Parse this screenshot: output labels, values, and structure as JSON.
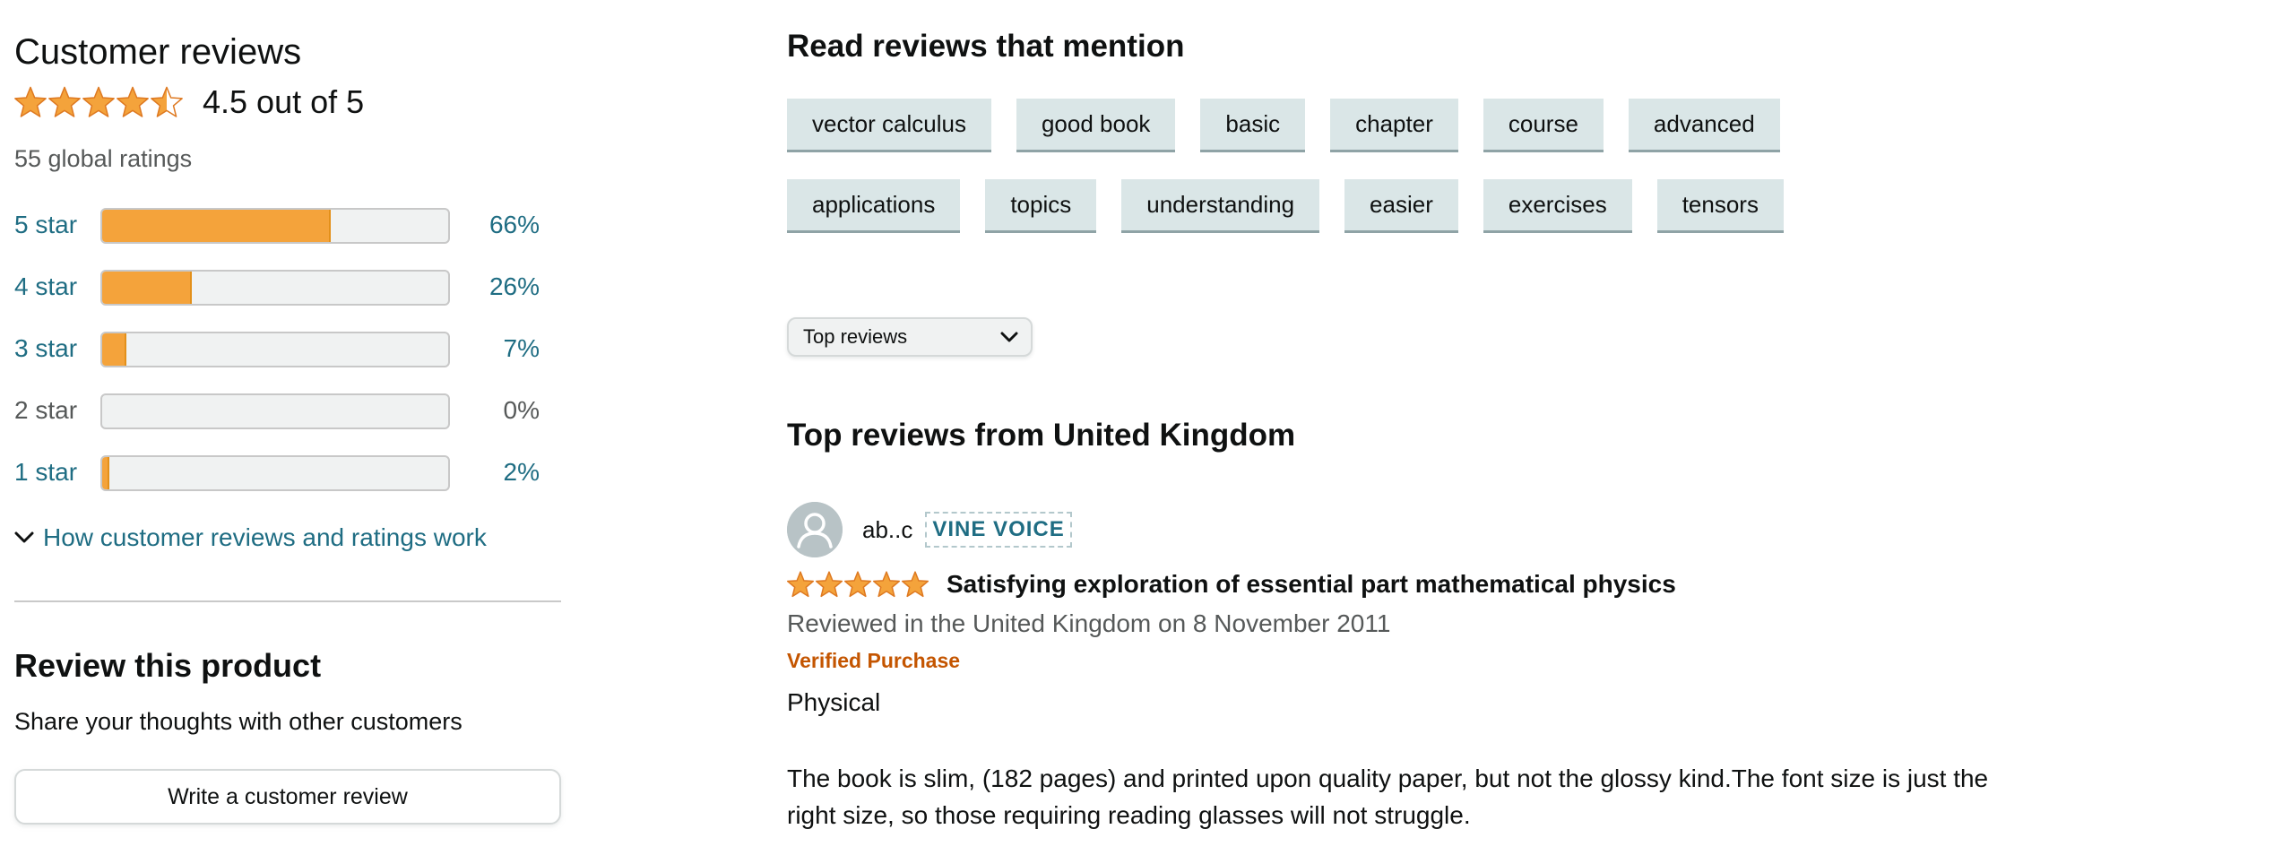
{
  "colors": {
    "link": "#1f6d83",
    "star": "#f4a33b",
    "verified": "#c45500",
    "chip_bg": "#dae6e7",
    "bar_bg": "#f0f2f2"
  },
  "summary": {
    "title": "Customer reviews",
    "rating": 4.5,
    "rating_text": "4.5 out of 5",
    "global_ratings": "55 global ratings"
  },
  "histogram": [
    {
      "label": "5 star",
      "percent_text": "66%",
      "percent": 66,
      "link": true
    },
    {
      "label": "4 star",
      "percent_text": "26%",
      "percent": 26,
      "link": true
    },
    {
      "label": "3 star",
      "percent_text": "7%",
      "percent": 7,
      "link": true
    },
    {
      "label": "2 star",
      "percent_text": "0%",
      "percent": 0,
      "link": false
    },
    {
      "label": "1 star",
      "percent_text": "2%",
      "percent": 2,
      "link": true
    }
  ],
  "how_link": "How customer reviews and ratings work",
  "review_product": {
    "title": "Review this product",
    "subtitle": "Share your thoughts with other customers",
    "button": "Write a customer review"
  },
  "mentions": {
    "title": "Read reviews that mention",
    "row1": [
      "vector calculus",
      "good book",
      "basic",
      "chapter",
      "course",
      "advanced"
    ],
    "row2": [
      "applications",
      "topics",
      "understanding",
      "easier",
      "exercises",
      "tensors"
    ]
  },
  "sort": {
    "selected": "Top reviews",
    "icon": "chevron-down-icon"
  },
  "top_reviews_title": "Top reviews from United Kingdom",
  "review": {
    "reviewer": "ab..c",
    "badge": "VINE VOICE",
    "rating": 5,
    "title": "Satisfying exploration of essential part mathematical physics",
    "date": "Reviewed in the United Kingdom on 8 November 2011",
    "verified": "Verified Purchase",
    "format": "Physical",
    "body": "The book is slim, (182 pages) and printed upon quality paper, but not the glossy kind.The font size is just the right size, so those requiring reading glasses will not struggle."
  }
}
